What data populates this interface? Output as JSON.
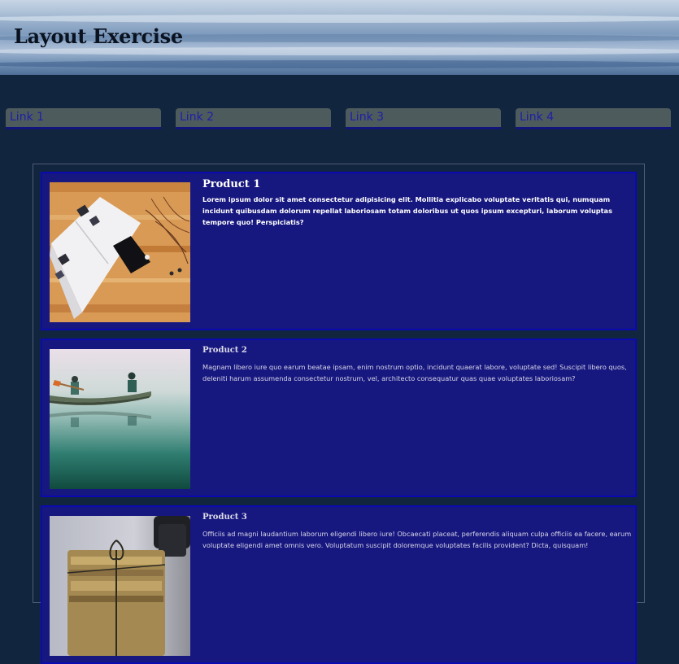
{
  "header": {
    "title": "Layout Exercise"
  },
  "nav": {
    "links": [
      {
        "label": "Link 1"
      },
      {
        "label": "Link 2"
      },
      {
        "label": "Link 3"
      },
      {
        "label": "Link 4"
      }
    ]
  },
  "products": [
    {
      "name": "Product 1",
      "description": "Lorem ipsum dolor sit amet consectetur adipisicing elit. Mollitia explicabo voluptate veritatis qui, numquam incidunt quibusdam dolorum repellat laboriosam totam doloribus ut quos ipsum excepturi, laborum voluptas tempore quo! Perspiciatis?",
      "image": "notebook-on-wooden-desk"
    },
    {
      "name": "Product 2",
      "description": "Magnam libero iure quo earum beatae ipsam, enim nostrum optio, incidunt quaerat labore, voluptate sed! Suscipit libero quos, deleniti harum assumenda consectetur nostrum, vel, architecto consequatur quas quae voluptates laboriosam?",
      "image": "canoe-on-misty-lake"
    },
    {
      "name": "Product 3",
      "description": "Officiis ad magni laudantium laborum eligendi libero iure! Obcaecati placeat, perferendis aliquam culpa officiis ea facere, earum voluptate eligendi amet omnis vero. Voluptatum suscipit doloremque voluptates facilis provident? Dicta, quisquam!",
      "image": "tied-old-books-and-inkwell"
    }
  ],
  "colors": {
    "page_background": "#12253f",
    "nav_link_background": "#4d5b5d",
    "nav_link_text": "#1e1ea8",
    "product_background": "#171780",
    "product_border": "#0a0ab0"
  }
}
